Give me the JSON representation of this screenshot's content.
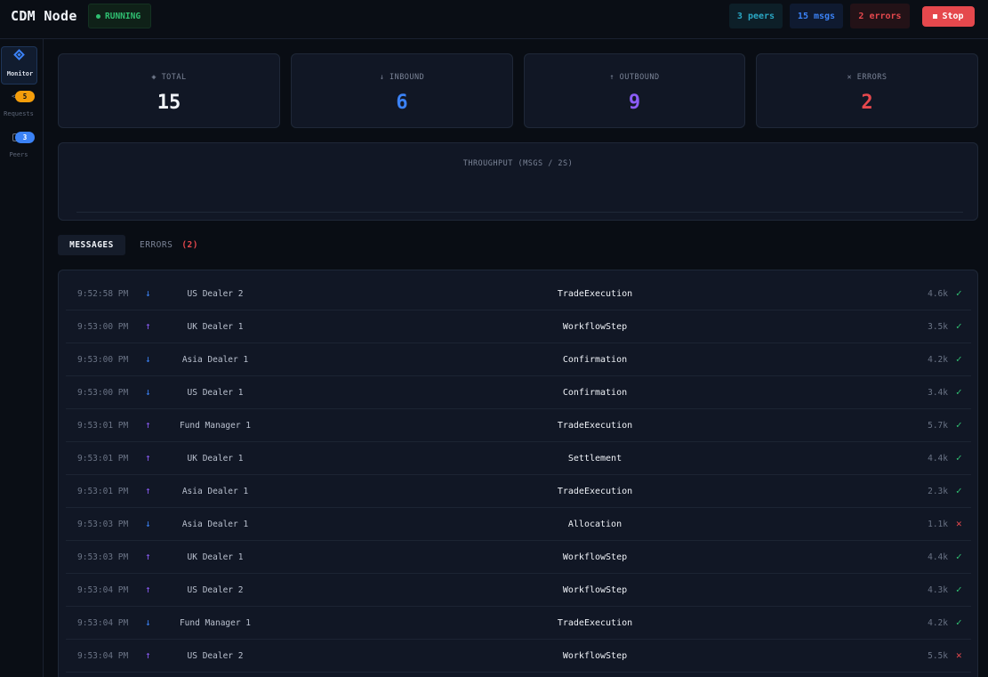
{
  "header": {
    "title": "CDM Node",
    "status": "RUNNING",
    "peers_badge": "3 peers",
    "msgs_badge": "15 msgs",
    "errors_badge": "2 errors",
    "stop_label": "Stop"
  },
  "sidebar": {
    "monitor_label": "Monitor",
    "requests_label": "Requests",
    "requests_count": "5",
    "peers_label": "Peers",
    "peers_count": "3"
  },
  "stats": {
    "total": {
      "label": "◈ TOTAL",
      "value": "15"
    },
    "inbound": {
      "label": "↓ INBOUND",
      "value": "6"
    },
    "outbound": {
      "label": "↑ OUTBOUND",
      "value": "9"
    },
    "errors": {
      "label": "✕ ERRORS",
      "value": "2"
    }
  },
  "throughput": {
    "label": "THROUGHPUT (MSGS / 2S)"
  },
  "tabs": {
    "messages": "MESSAGES",
    "errors": "ERRORS",
    "errors_count": "(2)"
  },
  "colors": {
    "accent": "#3b82f6",
    "success": "#2fbf71",
    "danger": "#e5484d",
    "outbound": "#8b5cf6",
    "warning": "#f59e0b"
  },
  "messages": [
    {
      "time": "9:52:58 PM",
      "dir": "in",
      "party": "US Dealer 2",
      "type": "TradeExecution",
      "size": "4.6k",
      "ok": true
    },
    {
      "time": "9:53:00 PM",
      "dir": "out",
      "party": "UK Dealer 1",
      "type": "WorkflowStep",
      "size": "3.5k",
      "ok": true
    },
    {
      "time": "9:53:00 PM",
      "dir": "in",
      "party": "Asia Dealer 1",
      "type": "Confirmation",
      "size": "4.2k",
      "ok": true
    },
    {
      "time": "9:53:00 PM",
      "dir": "in",
      "party": "US Dealer 1",
      "type": "Confirmation",
      "size": "3.4k",
      "ok": true
    },
    {
      "time": "9:53:01 PM",
      "dir": "out",
      "party": "Fund Manager 1",
      "type": "TradeExecution",
      "size": "5.7k",
      "ok": true
    },
    {
      "time": "9:53:01 PM",
      "dir": "out",
      "party": "UK Dealer 1",
      "type": "Settlement",
      "size": "4.4k",
      "ok": true
    },
    {
      "time": "9:53:01 PM",
      "dir": "out",
      "party": "Asia Dealer 1",
      "type": "TradeExecution",
      "size": "2.3k",
      "ok": true
    },
    {
      "time": "9:53:03 PM",
      "dir": "in",
      "party": "Asia Dealer 1",
      "type": "Allocation",
      "size": "1.1k",
      "ok": false
    },
    {
      "time": "9:53:03 PM",
      "dir": "out",
      "party": "UK Dealer 1",
      "type": "WorkflowStep",
      "size": "4.4k",
      "ok": true
    },
    {
      "time": "9:53:04 PM",
      "dir": "out",
      "party": "US Dealer 2",
      "type": "WorkflowStep",
      "size": "4.3k",
      "ok": true
    },
    {
      "time": "9:53:04 PM",
      "dir": "in",
      "party": "Fund Manager 1",
      "type": "TradeExecution",
      "size": "4.2k",
      "ok": true
    },
    {
      "time": "9:53:04 PM",
      "dir": "out",
      "party": "US Dealer 2",
      "type": "WorkflowStep",
      "size": "5.5k",
      "ok": false
    }
  ]
}
